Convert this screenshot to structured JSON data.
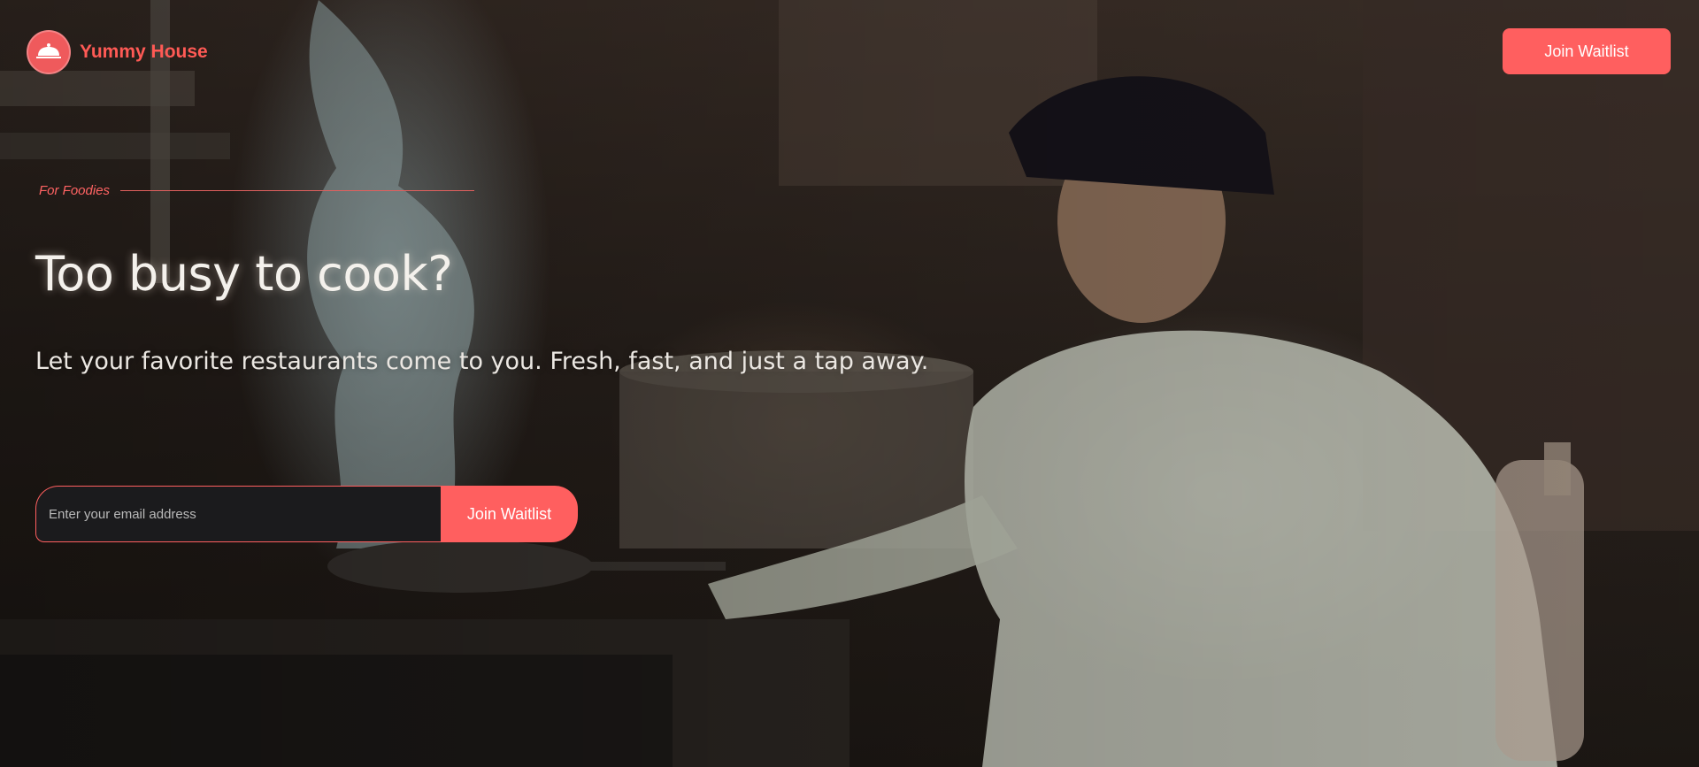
{
  "brand": {
    "name": "Yummy House",
    "logo_icon": "cloche-icon",
    "logo_text": "Yummy House"
  },
  "nav": {
    "cta_label": "Join Waitlist"
  },
  "hero": {
    "eyebrow": "For Foodies",
    "headline": "Too busy to cook?",
    "subheadline": "Let your favorite restaurants come to you. Fresh, fast, and just a tap away."
  },
  "signup": {
    "email_placeholder": "Enter your email address",
    "email_value": "",
    "button_label": "Join Waitlist"
  },
  "colors": {
    "accent": "#ff5f5f",
    "brand_text": "#ff5a55",
    "input_bg": "#1b1b1d"
  }
}
